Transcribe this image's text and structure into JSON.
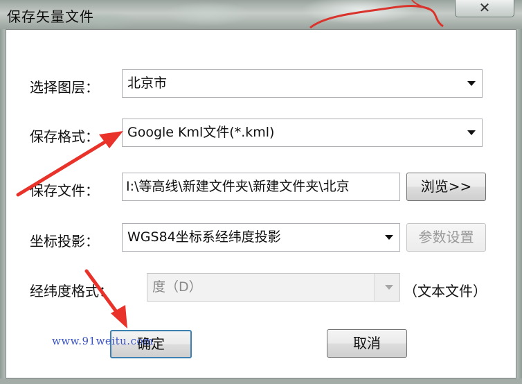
{
  "window": {
    "title": "保存矢量文件",
    "close_label": "✕"
  },
  "layer": {
    "label": "选择图层：",
    "value": "北京市"
  },
  "format": {
    "label": "保存格式：",
    "value": "Google Kml文件(*.kml)"
  },
  "file": {
    "label": "保存文件：",
    "value": "I:\\等高线\\新建文件夹\\新建文件夹\\北京",
    "browse_label": "浏览>>"
  },
  "projection": {
    "label": "坐标投影：",
    "value": "WGS84坐标系经纬度投影",
    "params_label": "参数设置"
  },
  "coord_format": {
    "label": "经纬度格式：",
    "value": "度（D）",
    "suffix": "（文本文件）"
  },
  "buttons": {
    "ok_label": "确定",
    "cancel_label": "取消"
  },
  "watermark": "www.91weitu.com",
  "colors": {
    "annotation_arrow": "#e8322a",
    "default_button_border": "#3c7fb1",
    "watermark": "#3b55c4"
  }
}
